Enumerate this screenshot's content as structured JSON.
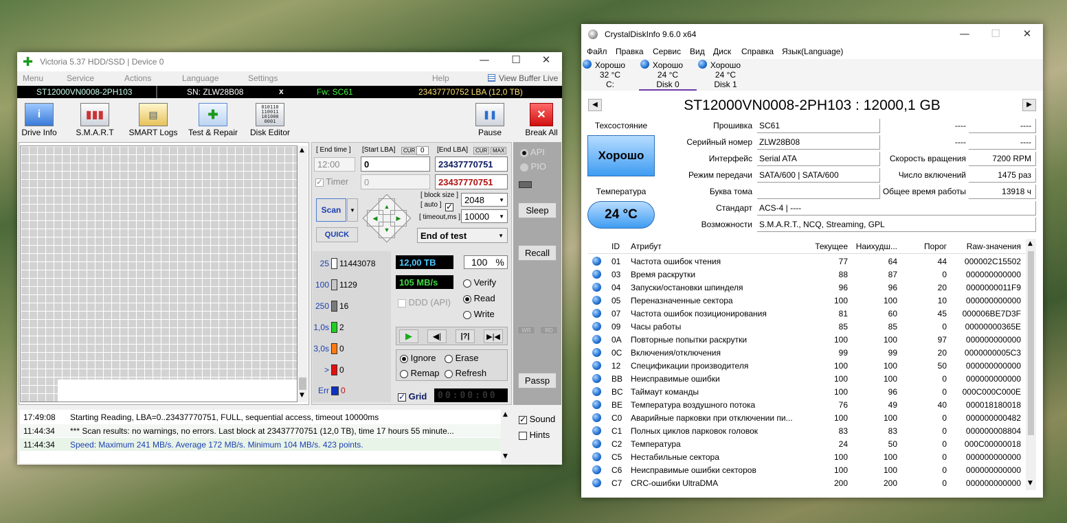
{
  "victoria": {
    "title": "Victoria 5.37 HDD/SSD | Device 0",
    "menu": [
      "Menu",
      "Service",
      "Actions",
      "Language",
      "Settings",
      "Help"
    ],
    "view_buffer": "View Buffer Live",
    "info": {
      "model": "ST12000VN0008-2PH103",
      "serial": "SN: ZLW28B08",
      "x": "x",
      "fw": "Fw: SC61",
      "lba": "23437770752 LBA (12,0 TB)"
    },
    "toolbar": {
      "drive_info": "Drive Info",
      "smart": "S.M.A.R.T",
      "smart_logs": "SMART Logs",
      "test_repair": "Test & Repair",
      "disk_editor": "Disk Editor",
      "pause": "Pause",
      "break_all": "Break All"
    },
    "end_time_label": "[ End time ]",
    "end_time": "12:00",
    "start_lba_label": "[Start LBA]",
    "cur": "CUR",
    "cur_val": "0",
    "end_lba_label": "[End LBA]",
    "cur2": "CUR",
    "max": "MAX",
    "start_lba": "0",
    "end_lba": "23437770751",
    "timer_label": "Timer",
    "timer_val": "0",
    "end_lba2": "23437770751",
    "scan": "Scan",
    "quick": "QUICK",
    "block_size_label": "[ block size ]",
    "auto_label": "[ auto ]",
    "block_size": "2048",
    "timeout_label": "[ timeout,ms ]",
    "timeout": "10000",
    "end_of_test": "End of test",
    "api": "API",
    "pio": "PIO",
    "sleep": "Sleep",
    "recall": "Recall",
    "passp": "Passp",
    "wr": "WR",
    "rd": "RD",
    "legend": [
      {
        "ms": "25",
        "count": "11443078",
        "color": "#ffffff"
      },
      {
        "ms": "100",
        "count": "1129",
        "color": "#c8c8c8"
      },
      {
        "ms": "250",
        "count": "16",
        "color": "#7a7a7a"
      },
      {
        "ms": "1,0s",
        "count": "2",
        "color": "#22cc22"
      },
      {
        "ms": "3,0s",
        "count": "0",
        "color": "#ff7a10"
      },
      {
        "ms": ">",
        "count": "0",
        "color": "#e01010"
      },
      {
        "ms": "Err",
        "count": "0",
        "color": "#1030c0"
      }
    ],
    "tb_done": "12,00 TB",
    "percent": "100",
    "pct_sign": "%",
    "speed": "105 MB/s",
    "verify": "Verify",
    "read": "Read",
    "write": "Write",
    "ddd": "DDD (API)",
    "ignore": "Ignore",
    "erase": "Erase",
    "remap": "Remap",
    "refresh": "Refresh",
    "grid": "Grid",
    "clock": "00:00:00",
    "sound": "Sound",
    "hints": "Hints",
    "log": [
      {
        "time": "17:49:08",
        "text": "Starting Reading, LBA=0..23437770751, FULL, sequential access, timeout 10000ms",
        "color": "#000000"
      },
      {
        "time": "11:44:34",
        "text": "*** Scan results: no warnings, no errors. Last block at 23437770751 (12,0 TB), time 17 hours 55 minute...",
        "color": "#000000"
      },
      {
        "time": "11:44:34",
        "text": "Speed: Maximum 241 MB/s. Average 172 MB/s. Minimum 104 MB/s. 423 points.",
        "color": "#1a3fb0"
      }
    ]
  },
  "crystal": {
    "title": "CrystalDiskInfo 9.6.0 x64",
    "menu": [
      "Файл",
      "Правка",
      "Сервис",
      "Вид",
      "Диск",
      "Справка",
      "Язык(Language)"
    ],
    "disks": [
      {
        "status": "Хорошо",
        "temp": "32 °C",
        "name": "C:"
      },
      {
        "status": "Хорошо",
        "temp": "24 °C",
        "name": "Disk 0"
      },
      {
        "status": "Хорошо",
        "temp": "24 °C",
        "name": "Disk 1"
      }
    ],
    "model": "ST12000VN0008-2PH103 : 12000,1 GB",
    "health_label": "Техсостояние",
    "health": "Хорошо",
    "temp_label": "Температура",
    "temp": "24 °C",
    "fields": {
      "fw_label": "Прошивка",
      "fw": "SC61",
      "sn_label": "Серийный номер",
      "sn": "ZLW28B08",
      "if_label": "Интерфейс",
      "if": "Serial ATA",
      "mode_label": "Режим передачи",
      "mode": "SATA/600 | SATA/600",
      "vol_label": "Буква тома",
      "vol": "",
      "std_label": "Стандарт",
      "std": "ACS-4 | ----",
      "feat_label": "Возможности",
      "feat": "S.M.A.R.T., NCQ, Streaming, GPL",
      "r1_label": "----",
      "r1": "----",
      "r2_label": "----",
      "r2": "----",
      "rpm_label": "Скорость вращения",
      "rpm": "7200 RPM",
      "pc_label": "Число включений",
      "pc": "1475 раз",
      "hours_label": "Общее время работы",
      "hours": "13918 ч"
    },
    "table_headers": [
      "ID",
      "Атрибут",
      "Текущее",
      "Наихудш...",
      "Порог",
      "Raw-значения"
    ],
    "rows": [
      [
        "01",
        "Частота ошибок чтения",
        "77",
        "64",
        "44",
        "000002C15502"
      ],
      [
        "03",
        "Время раскрутки",
        "88",
        "87",
        "0",
        "000000000000"
      ],
      [
        "04",
        "Запуски/остановки шпинделя",
        "96",
        "96",
        "20",
        "0000000011F9"
      ],
      [
        "05",
        "Переназначенные сектора",
        "100",
        "100",
        "10",
        "000000000000"
      ],
      [
        "07",
        "Частота ошибок позиционирования",
        "81",
        "60",
        "45",
        "000006BE7D3F"
      ],
      [
        "09",
        "Часы работы",
        "85",
        "85",
        "0",
        "00000000365E"
      ],
      [
        "0A",
        "Повторные попытки раскрутки",
        "100",
        "100",
        "97",
        "000000000000"
      ],
      [
        "0C",
        "Включения/отключения",
        "99",
        "99",
        "20",
        "0000000005C3"
      ],
      [
        "12",
        "Спецификации производителя",
        "100",
        "100",
        "50",
        "000000000000"
      ],
      [
        "BB",
        "Неисправимые ошибки",
        "100",
        "100",
        "0",
        "000000000000"
      ],
      [
        "BC",
        "Таймаут команды",
        "100",
        "96",
        "0",
        "000C000C000E"
      ],
      [
        "BE",
        "Температура воздушного потока",
        "76",
        "49",
        "40",
        "000018180018"
      ],
      [
        "C0",
        "Аварийные парковки при отключении пи...",
        "100",
        "100",
        "0",
        "000000000482"
      ],
      [
        "C1",
        "Полных циклов парковок головок",
        "83",
        "83",
        "0",
        "000000008804"
      ],
      [
        "C2",
        "Температура",
        "24",
        "50",
        "0",
        "000C00000018"
      ],
      [
        "C5",
        "Нестабильные сектора",
        "100",
        "100",
        "0",
        "000000000000"
      ],
      [
        "C6",
        "Неисправимые ошибки секторов",
        "100",
        "100",
        "0",
        "000000000000"
      ],
      [
        "C7",
        "CRC-ошибки UltraDMA",
        "200",
        "200",
        "0",
        "000000000000"
      ]
    ]
  }
}
